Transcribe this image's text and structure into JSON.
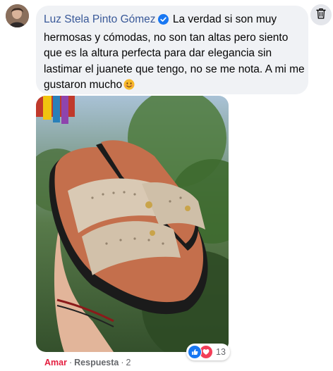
{
  "comment": {
    "author": "Luz Stela Pinto Gómez",
    "text": "La verdad si son muy hermosas y cómodas, no son tan altas pero siento que es la altura perfecta para dar elegancia sin lastimar el juanete que tengo, no se me nota. A mi me gustaron mucho",
    "emoji_icon": "smiling-face-icon",
    "verified_icon": "verified-badge-icon",
    "author_color": "#385898"
  },
  "reactions": {
    "count": "13",
    "icons": [
      "like-icon",
      "love-icon"
    ]
  },
  "actions": {
    "like_label": "Amar",
    "reply_label": "Respuesta",
    "reply_count": "2",
    "like_color": "#e41e3f"
  },
  "delete_icon": "trash-icon"
}
